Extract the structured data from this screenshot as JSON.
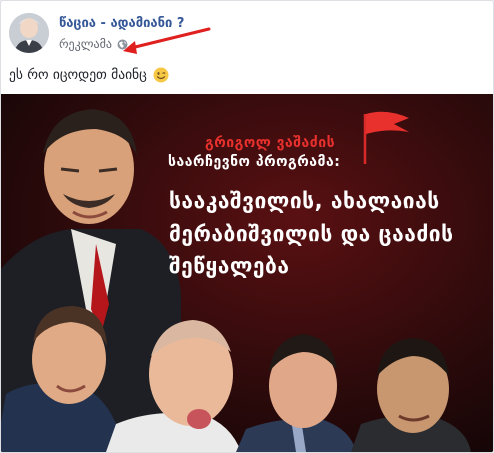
{
  "post": {
    "page_name": "წაცია - ადამიანი ?",
    "sponsored_label": "რეკლამა",
    "text": "ეს რო იცოდეთ მაინც"
  },
  "ad": {
    "headline": "გრიგოლ ვაშაძის",
    "subhead": "საარჩევნო პროგრამა:",
    "title_lines": [
      "სააკაშვილის, ახალაიას",
      "მერაბიშვილის და ცააძის",
      "შეწყალება"
    ]
  },
  "colors": {
    "link": "#365899",
    "annotation_arrow": "#e0201f",
    "headline_red": "#e8302d",
    "ad_background": "#1b0b0c"
  },
  "icons": [
    "globe-icon",
    "smiley-icon",
    "flag-icon"
  ]
}
